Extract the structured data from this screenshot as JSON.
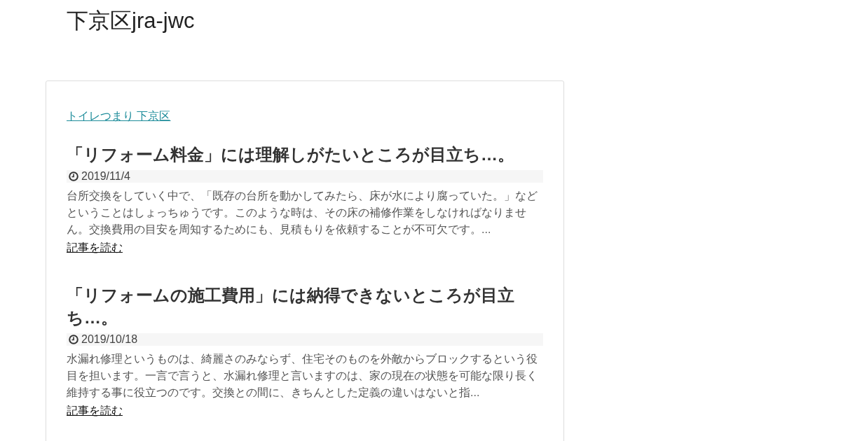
{
  "site_title": "下京区jra-jwc",
  "category_link": "トイレつまり 下京区",
  "posts": [
    {
      "title": "「リフォーム料金」には理解しがたいところが目立ち…。",
      "date": "2019/11/4",
      "excerpt": "台所交換をしていく中で、「既存の台所を動かしてみたら、床が水により腐っていた。」などということはしょっちゅうです。このような時は、その床の補修作業をしなければなりません。交換費用の目安を周知するためにも、見積もりを依頼することが不可欠です。...",
      "read_more": "記事を読む"
    },
    {
      "title": "「リフォームの施工費用」には納得できないところが目立ち…。",
      "date": "2019/10/18",
      "excerpt": "水漏れ修理というものは、綺麗さのみならず、住宅そのものを外敵からブロックするという役目を担います。一言で言うと、水漏れ修理と言いますのは、家の現在の状態を可能な限り長く維持する事に役立つのです。交換との間に、きちんとした定義の違いはないと指...",
      "read_more": "記事を読む"
    }
  ]
}
